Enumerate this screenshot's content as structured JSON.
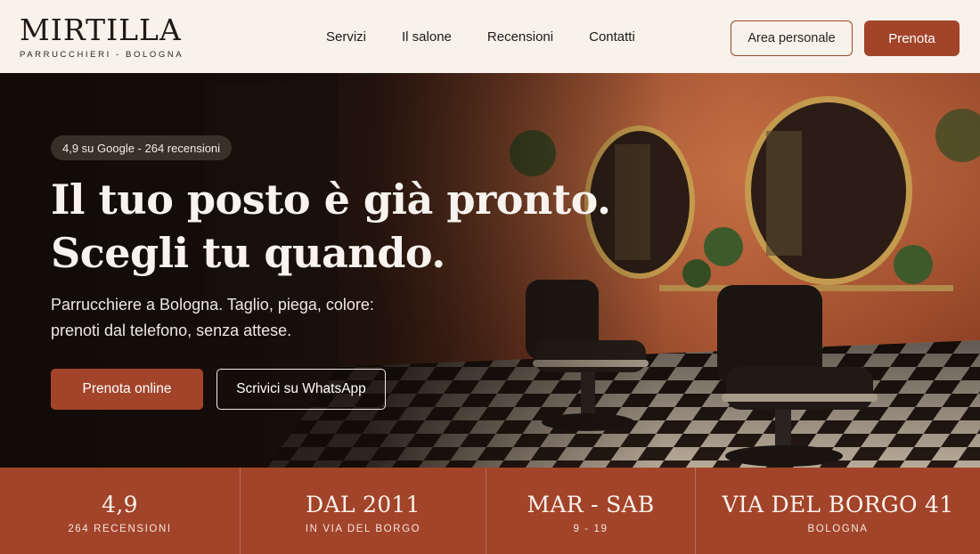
{
  "header": {
    "logo_name": "MIRTILLA",
    "logo_sub": "PARRUCCHIERI - BOLOGNA",
    "nav": [
      "Servizi",
      "Il salone",
      "Recensioni",
      "Contatti"
    ],
    "area_label": "Area personale",
    "prenota_label": "Prenota"
  },
  "hero": {
    "badge": "4,9 su Google - 264 recensioni",
    "headline_line1": "Il tuo posto è già pronto.",
    "headline_line2": "Scegli tu quando.",
    "subtext_line1": "Parrucchiere a Bologna. Taglio, piega, colore:",
    "subtext_line2": "prenoti dal telefono, senza attese.",
    "cta_primary": "Prenota online",
    "cta_secondary": "Scrivici su WhatsApp"
  },
  "stats": [
    {
      "value": "4,9",
      "label": "264 RECENSIONI"
    },
    {
      "value": "DAL 2011",
      "label": "IN VIA DEL BORGO"
    },
    {
      "value": "MAR - SAB",
      "label": "9 - 19"
    },
    {
      "value": "VIA DEL BORGO 41",
      "label": "BOLOGNA"
    }
  ],
  "colors": {
    "accent": "#a2442a",
    "header_bg": "#f7f2ea",
    "hero_wall": "#9c4a2c"
  }
}
